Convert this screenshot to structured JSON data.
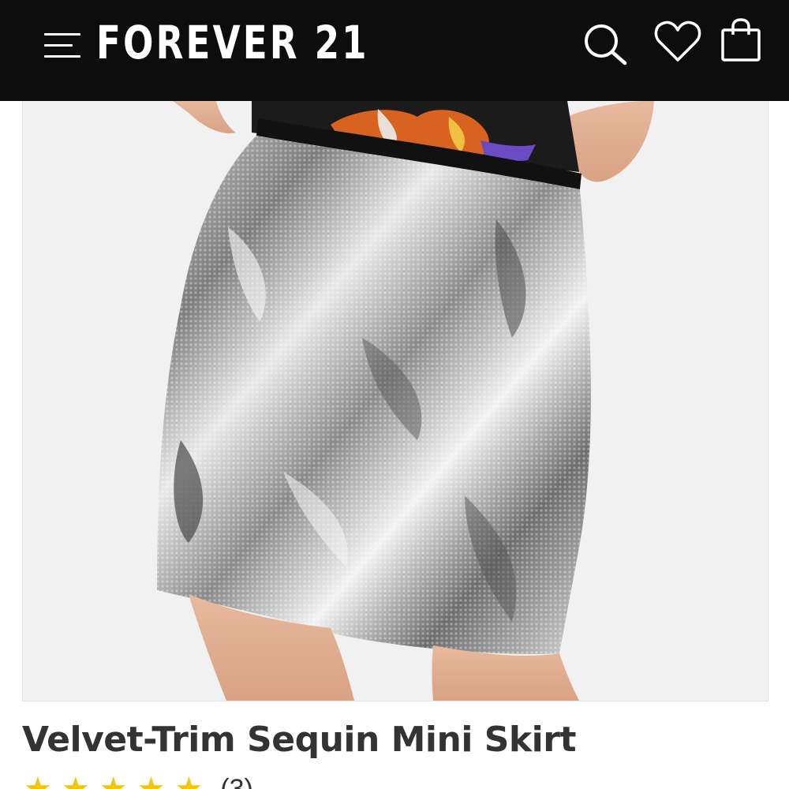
{
  "header": {
    "logo": "FOREVER 21",
    "menu_icon": "hamburger-menu-icon",
    "search_icon": "search-icon",
    "wishlist_icon": "heart-icon",
    "bag_icon": "shopping-bag-icon",
    "background_color": "#0d0d0d",
    "icon_color": "#ffffff"
  },
  "product": {
    "image_description_icon": "product-image",
    "title": "Velvet-Trim Sequin Mini Skirt",
    "rating_icon": "star-icon",
    "review_count_text": "(3)",
    "star_color": "#f1c40f"
  }
}
